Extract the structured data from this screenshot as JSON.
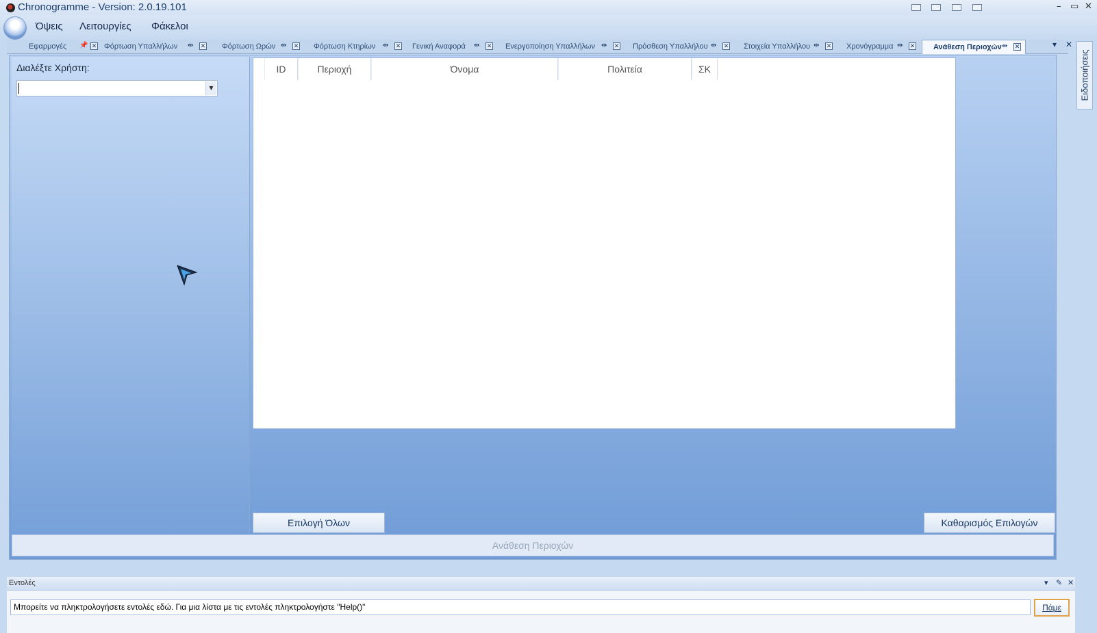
{
  "window": {
    "title": "Chronogramme - Version: 2.0.19.101",
    "controls": [
      "–",
      "▭",
      "✕"
    ]
  },
  "menu": [
    "Όψεις",
    "Λειτουργίες",
    "Φάκελοι"
  ],
  "tabs": [
    {
      "label": "Εφαρμογές",
      "pin": "📌"
    },
    {
      "label": "Φόρτωση Υπαλλήλων",
      "pin": "⇹"
    },
    {
      "label": "Φόρτωση Ωρών",
      "pin": "⇹"
    },
    {
      "label": "Φόρτωση Κτηρίων",
      "pin": "⇹"
    },
    {
      "label": "Γενική Αναφορά",
      "pin": "⇹"
    },
    {
      "label": "Ενεργοποίηση Υπαλλήλων",
      "pin": "⇹"
    },
    {
      "label": "Πρόσθεση Υπαλλήλου",
      "pin": "⇹"
    },
    {
      "label": "Στοιχεία Υπαλλήλου",
      "pin": "⇹"
    },
    {
      "label": "Χρονόγραμμα",
      "pin": "⇹"
    },
    {
      "label": "Ανάθεση Περιοχών",
      "pin": "⇹"
    }
  ],
  "active_tab": "Ανάθεση Περιοχών",
  "left_panel": {
    "choose_label": "Διαλέξτε Χρήστη:",
    "user_value": ""
  },
  "grid": {
    "columns": [
      "ID",
      "Περιοχή",
      "Όνομα",
      "Πολιτεία",
      "ΣΚ"
    ]
  },
  "buttons": {
    "select_all": "Επιλογή Όλων",
    "clear": "Καθαρισμός Επιλογών",
    "assign": "Ανάθεση Περιοχών"
  },
  "side_tab": "Ειδοποιήσεις",
  "commands": {
    "title": "Εντολές",
    "input_value": "Μπορείτε να πληκτρολογήσετε εντολές εδώ. Για μια λίστα με τις εντολές πληκτρολογήστε \"Help()\"",
    "go": "Πάμε"
  }
}
